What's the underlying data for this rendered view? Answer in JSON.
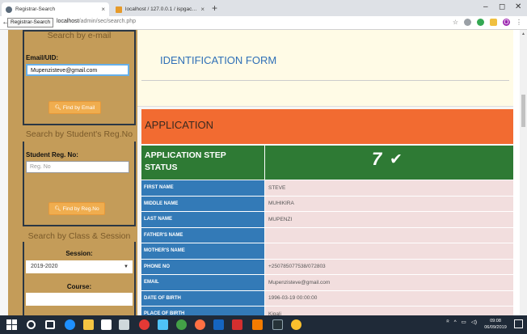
{
  "browser": {
    "tabs": [
      {
        "title": "Registrar-Search",
        "active": true
      },
      {
        "title": "localhost / 127.0.0.1 / ispgac_iu...",
        "active": false
      }
    ],
    "new_tab_label": "+",
    "window_controls": [
      "–",
      "◻",
      "✕"
    ],
    "back_label": "←",
    "url_tooltip": "Registrar-Search",
    "url_host": "localhost",
    "url_path": "/admin/sec/search.php",
    "tab_close": "×",
    "star_label": "☆",
    "profile_initial": "O"
  },
  "sidebar": {
    "email_box": {
      "title": "Search by e-mail",
      "label": "Email/UID:",
      "value": "Mupenzisteve@gmail.com",
      "button": "Find by Email"
    },
    "regno_box": {
      "title": "Search by Student's Reg.No",
      "label": "Student Reg. No:",
      "placeholder": "Reg. No",
      "button": "Find by Reg.No"
    },
    "class_box": {
      "title": "Search by Class & Session",
      "session_label": "Session:",
      "session_value": "2019-2020",
      "course_label": "Course:"
    }
  },
  "main": {
    "form_title": "IDENTIFICATION FORM",
    "application_title": "APPLICATION",
    "status_label": "APPLICATION STEP STATUS",
    "status_value": "7",
    "fields": [
      {
        "key": "FIRST NAME",
        "value": "STEVE"
      },
      {
        "key": "MIDDLE NAME",
        "value": "MUHIKIRA"
      },
      {
        "key": "LAST NAME",
        "value": "MUPENZI"
      },
      {
        "key": "FATHER'S NAME",
        "value": ""
      },
      {
        "key": "MOTHER'S NAME",
        "value": ""
      },
      {
        "key": "PHONE NO",
        "value": "+250785077538/072803"
      },
      {
        "key": "EMAIL",
        "value": "Mupenzisteve@gmail.com"
      },
      {
        "key": "DATE OF BIRTH",
        "value": "1996-03-19 00:00:00"
      },
      {
        "key": "PLACE OF BIRTH",
        "value": "Kigali"
      }
    ]
  },
  "taskbar": {
    "time": "09:08",
    "date": "06/09/2019"
  },
  "colors": {
    "sidebar": "#c49c59",
    "application": "#f26b31",
    "status": "#2e7a34",
    "field_key": "#337ab7",
    "field_value": "#f2dede",
    "button": "#f0ad4e"
  }
}
